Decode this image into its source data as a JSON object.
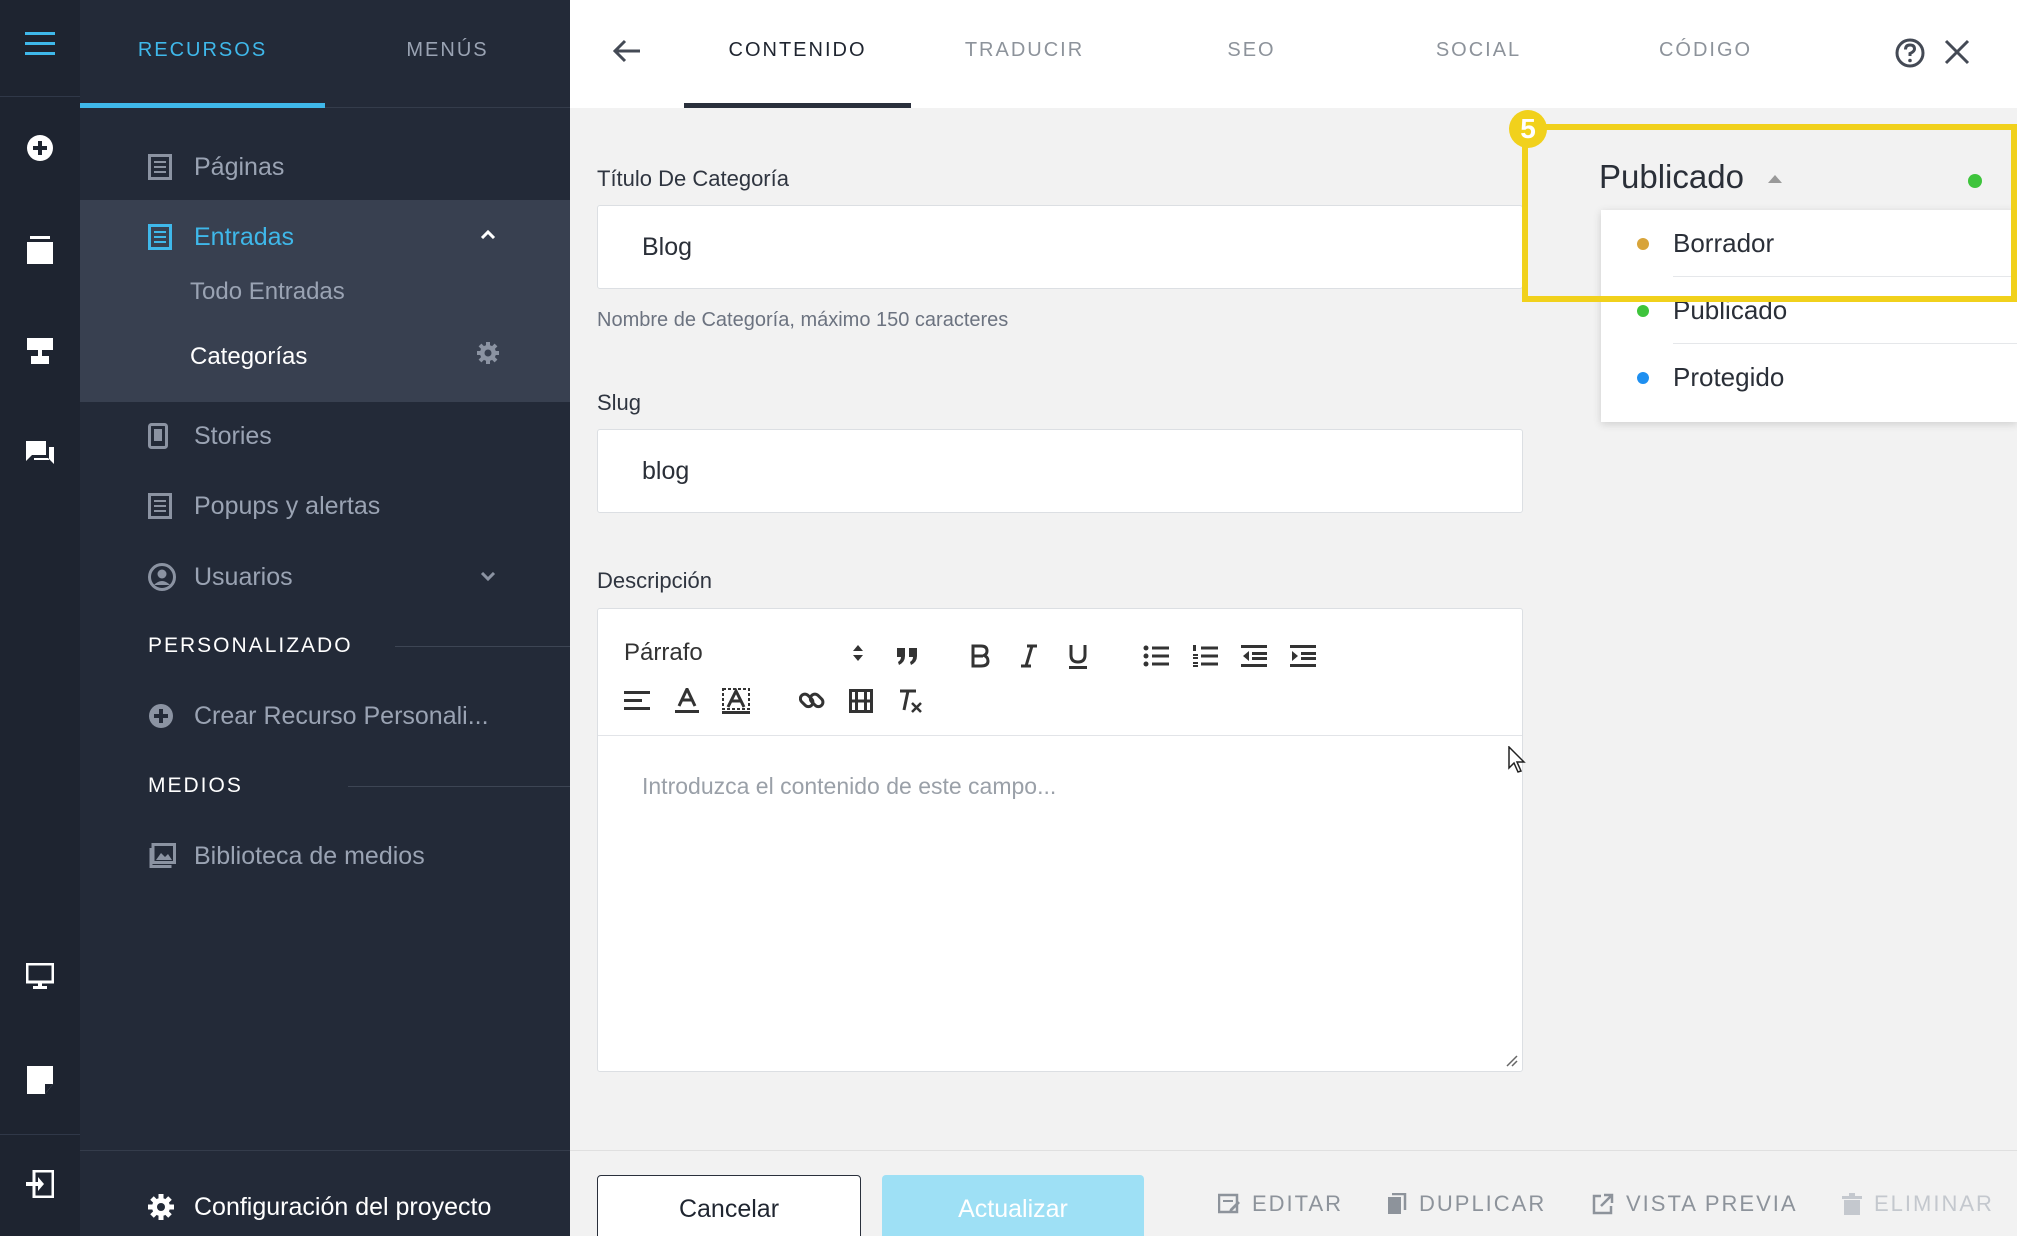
{
  "sidebar": {
    "tabs": [
      {
        "label": "RECURSOS",
        "active": true
      },
      {
        "label": "MENÚS",
        "active": false
      }
    ],
    "items": {
      "paginas": "Páginas",
      "entradas": "Entradas",
      "todo_entradas": "Todo Entradas",
      "categorias": "Categorías",
      "stories": "Stories",
      "popups": "Popups y alertas",
      "usuarios": "Usuarios",
      "crear_recurso": "Crear Recurso Personali...",
      "biblioteca": "Biblioteca de medios"
    },
    "sections": {
      "personalizado": "PERSONALIZADO",
      "medios": "MEDIOS"
    },
    "footer_label": "Configuración del proyecto"
  },
  "topbar": {
    "tabs": [
      "CONTENIDO",
      "TRADUCIR",
      "SEO",
      "SOCIAL",
      "CÓDIGO"
    ],
    "active_tab": "CONTENIDO"
  },
  "form": {
    "title_label": "Título De Categoría",
    "title_value": "Blog",
    "title_hint": "Nombre de Categoría, máximo 150 caracteres",
    "slug_label": "Slug",
    "slug_value": "blog",
    "description_label": "Descripción",
    "paragraph_select": "Párrafo",
    "description_placeholder": "Introduzca el contenido de este campo..."
  },
  "status": {
    "current": "Publicado",
    "options": [
      {
        "label": "Borrador",
        "color": "#d8a43a"
      },
      {
        "label": "Publicado",
        "color": "#3ec43c"
      },
      {
        "label": "Protegido",
        "color": "#1e8ff0"
      }
    ],
    "current_color": "#3ec43c",
    "step_badge": "5"
  },
  "footer": {
    "cancel": "Cancelar",
    "update": "Actualizar",
    "edit": "EDITAR",
    "duplicate": "DUPLICAR",
    "preview": "VISTA PREVIA",
    "delete": "ELIMINAR"
  },
  "colors": {
    "accent": "#3fb8ea",
    "highlight": "#f1d11c"
  }
}
